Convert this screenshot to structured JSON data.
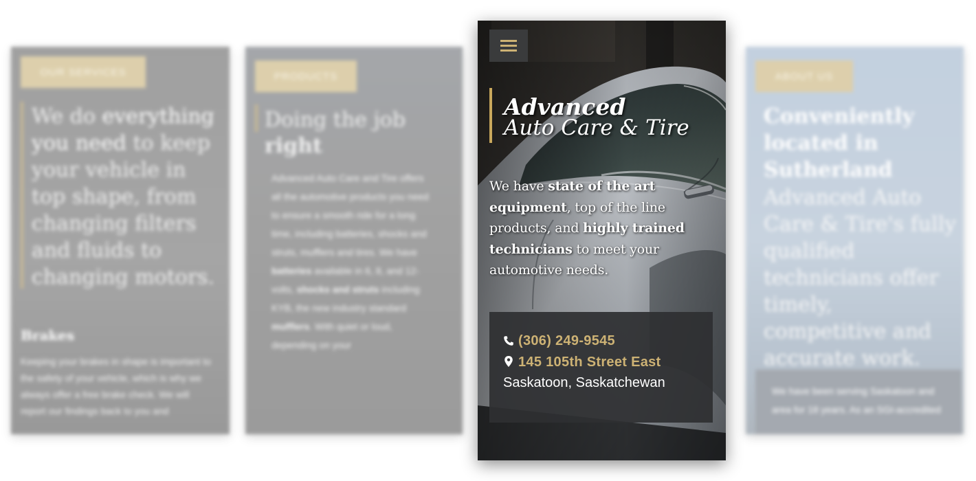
{
  "panels": {
    "left": {
      "pill_label": "OUR SERVICES",
      "lead_1": "We do ",
      "lead_bold": "everything you need",
      "lead_2": " to keep your vehicle in top shape, from changing filters and fluids to changing motors.",
      "subheading": "Brakes",
      "paragraph": "Keeping your brakes in shape is important to the safety of your vehicle, which is why we always offer a free brake check. We will report our findings back to you and"
    },
    "middle": {
      "pill_label": "PRODUCTS",
      "lead_1": "Doing the job ",
      "lead_bold": "right",
      "body_1": "Advanced Auto Care and Tire offers all the automotive products you need to ensure a smooth ride for a long time, including batteries, shocks and struts, mufflers and tires. We have ",
      "body_b1": "batteries",
      "body_2": " available in 6, 8, and 12-volts, ",
      "body_b2": "shocks and struts",
      "body_3": " including KYB, the new industry standard ",
      "body_b3": "mufflers",
      "body_4": ". With quiet or loud, depending on your"
    },
    "right": {
      "pill_label": "ABOUT US",
      "heading": "Conveniently located in Sutherland",
      "lead": "Advanced Auto Care & Tire's fully qualified technicians offer timely, competitive and accurate work.",
      "box_text": "We have been serving Saskatoon and area for 18 years. As an SGI-accredited"
    }
  },
  "card": {
    "menu_icon": "hamburger-menu-icon",
    "brand_line_1": "Advanced",
    "brand_line_2": "Auto Care & Tire",
    "intro_1": "We have ",
    "intro_b1": "state of the art equipment",
    "intro_2": ", top of the line products, and ",
    "intro_b2": "highly trained technicians",
    "intro_3": " to meet your automotive needs.",
    "contact": {
      "phone_icon": "phone-icon",
      "phone": "(306) 249-9545",
      "location_icon": "map-marker-icon",
      "street": "145 105th Street East",
      "city": "Saskatoon, Saskatchewan"
    }
  },
  "colors": {
    "accent_gold": "#cdb274",
    "pill_gold": "#c9b37a",
    "contact_box": "#2e2f32"
  }
}
